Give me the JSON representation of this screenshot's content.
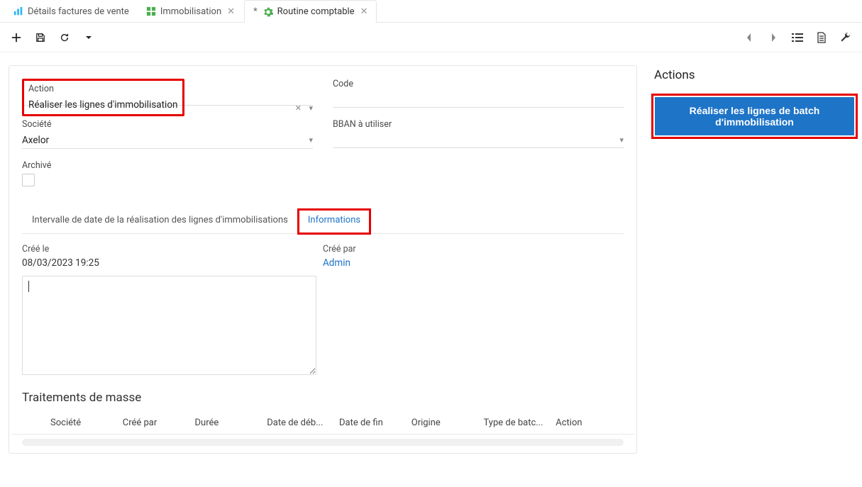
{
  "tabs": [
    {
      "label": "Détails factures de vente",
      "icon": "chart-bar-icon",
      "icon_color": "#29b6f6",
      "closable": false,
      "dirty": false
    },
    {
      "label": "Immobilisation",
      "icon": "grid-icon",
      "icon_color": "#4caf50",
      "closable": true,
      "dirty": false
    },
    {
      "label": "Routine comptable",
      "icon": "gear-icon",
      "icon_color": "#4caf50",
      "closable": true,
      "dirty": true
    }
  ],
  "active_tab_index": 2,
  "form": {
    "action": {
      "label": "Action",
      "value": "Réaliser les lignes d'immobilisation",
      "clearable": true
    },
    "code": {
      "label": "Code",
      "value": ""
    },
    "societe": {
      "label": "Société",
      "value": "Axelor"
    },
    "bban": {
      "label": "BBAN à utiliser",
      "value": ""
    },
    "archive": {
      "label": "Archivé",
      "checked": false
    }
  },
  "inner_tabs": [
    {
      "label": "Intervalle de date de la réalisation des lignes d'immobilisations"
    },
    {
      "label": "Informations"
    }
  ],
  "active_inner_tab_index": 1,
  "info": {
    "created_on": {
      "label": "Créé le",
      "value": "08/03/2023 19:25"
    },
    "created_by": {
      "label": "Créé par",
      "value": "Admin"
    },
    "textarea": ""
  },
  "mass": {
    "title": "Traitements de masse",
    "columns": [
      "Société",
      "Créé par",
      "Durée",
      "Date de déb...",
      "Date de fin",
      "Origine",
      "Type de batc...",
      "Action"
    ]
  },
  "side": {
    "title": "Actions",
    "button": "Réaliser les lignes de batch d'immobilisation"
  }
}
